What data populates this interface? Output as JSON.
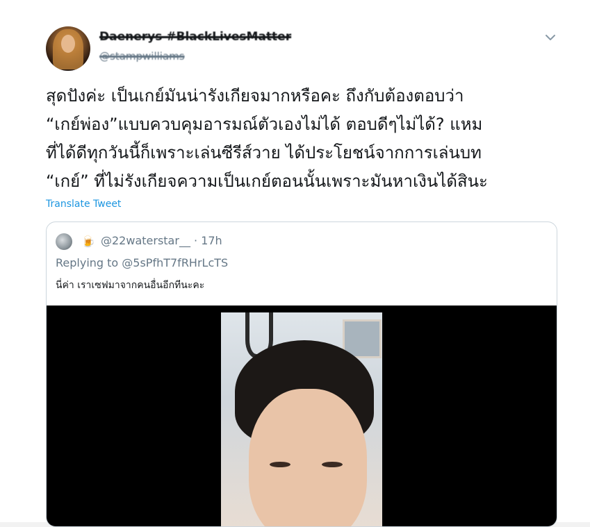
{
  "tweet": {
    "display_name": "Daenerys #BlackLivesMatter",
    "handle": "@stampwilliams",
    "text": "สุดปังค่ะ เป็นเกย์มันน่ารังเกียจมากหรือคะ ถึงกับต้องตอบว่า\n“เกย์พ่อง”แบบควบคุมอารมณ์ตัวเองไม่ได้ ตอบดีๆไม่ได้? แหม\nที่ได้ดีทุกวันนี้ก็เพราะเล่นซีรีส์วาย ได้ประโยชน์จากการเล่นบท\n“เกย์” ที่ไม่รังเกียจความเป็นเกย์ตอนนั้นเพราะมันหาเงินได้สินะ",
    "translate_label": "Translate Tweet",
    "menu_icon": "chevron-down-icon"
  },
  "quoted": {
    "emoji": "🍺",
    "handle_time": "@22waterstar__ · 17h",
    "replying_to": "Replying to @5sPfhT7fRHrLcTS",
    "text": "นี่ค่า เราเซฟมาจากคนอื่นอีกทีนะคะ"
  },
  "colors": {
    "link": "#1b95e0",
    "secondary_text": "#657786",
    "primary_text": "#14171a",
    "border": "#ccd6dd"
  }
}
